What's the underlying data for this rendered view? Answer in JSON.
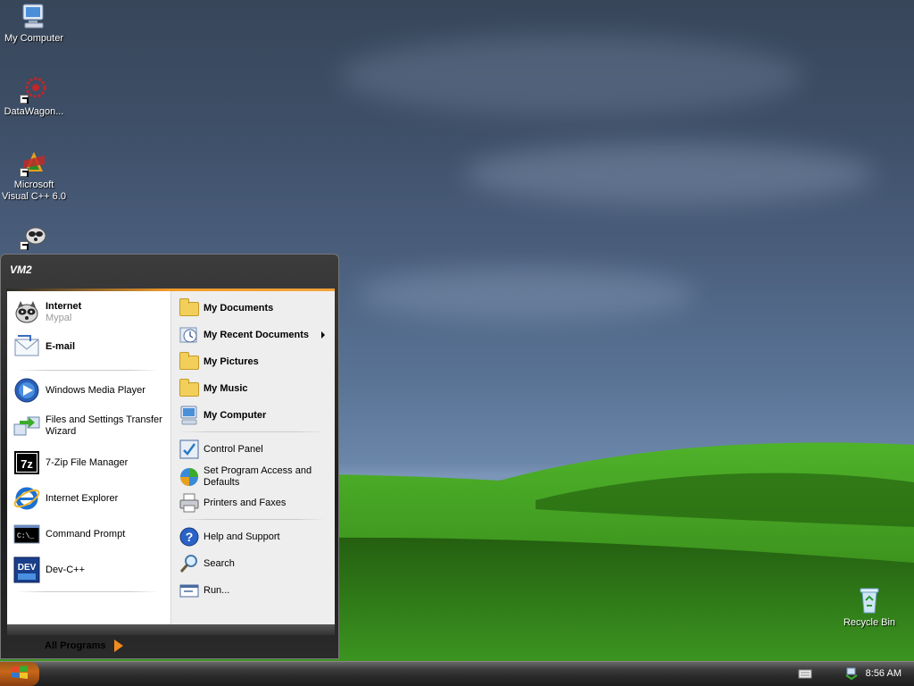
{
  "desktop": {
    "icons": [
      {
        "label": "My Computer",
        "icon": "my-computer-icon"
      },
      {
        "label": "DataWagon...",
        "icon": "datawagon-icon"
      },
      {
        "label": "Microsoft Visual C++ 6.0",
        "icon": "visual-cpp-icon"
      },
      {
        "label": "",
        "icon": "raccoon-icon"
      },
      {
        "label": "Recycle Bin",
        "icon": "recycle-bin-icon"
      }
    ]
  },
  "start_menu": {
    "user": "VM2",
    "pinned": [
      {
        "title": "Internet",
        "subtitle": "Mypal",
        "icon": "raccoon-icon"
      },
      {
        "title": "E-mail",
        "subtitle": "",
        "icon": "email-icon"
      }
    ],
    "recent": [
      {
        "label": "Windows Media Player",
        "icon": "media-player-icon"
      },
      {
        "label": "Files and Settings Transfer Wizard",
        "icon": "transfer-wizard-icon"
      },
      {
        "label": "7-Zip File Manager",
        "icon": "7zip-icon"
      },
      {
        "label": "Internet Explorer",
        "icon": "internet-explorer-icon"
      },
      {
        "label": "Command Prompt",
        "icon": "command-prompt-icon"
      },
      {
        "label": "Dev-C++",
        "icon": "devcpp-icon"
      }
    ],
    "all_programs": "All Programs",
    "places": [
      {
        "label": "My Documents",
        "icon": "folder-icon",
        "bold": true
      },
      {
        "label": "My Recent Documents",
        "icon": "recent-documents-icon",
        "bold": true,
        "submenu": true
      },
      {
        "label": "My Pictures",
        "icon": "folder-icon",
        "bold": true
      },
      {
        "label": "My Music",
        "icon": "folder-icon",
        "bold": true
      },
      {
        "label": "My Computer",
        "icon": "my-computer-icon",
        "bold": true
      }
    ],
    "settings": [
      {
        "label": "Control Panel",
        "icon": "control-panel-icon"
      },
      {
        "label": "Set Program Access and Defaults",
        "icon": "program-access-icon"
      },
      {
        "label": "Printers and Faxes",
        "icon": "printer-icon"
      }
    ],
    "tools": [
      {
        "label": "Help and Support",
        "icon": "help-icon"
      },
      {
        "label": "Search",
        "icon": "search-icon"
      },
      {
        "label": "Run...",
        "icon": "run-icon"
      }
    ]
  },
  "taskbar": {
    "start_icon": "windows-logo-icon",
    "tray_icons": [
      "keyboard-icon",
      "network-icon"
    ],
    "clock": "8:56 AM"
  },
  "colors": {
    "accent": "#f39c2b",
    "menu_dark": "#1c1c1c",
    "sky": "#4a5e7c",
    "grass": "#3e9a1e"
  }
}
